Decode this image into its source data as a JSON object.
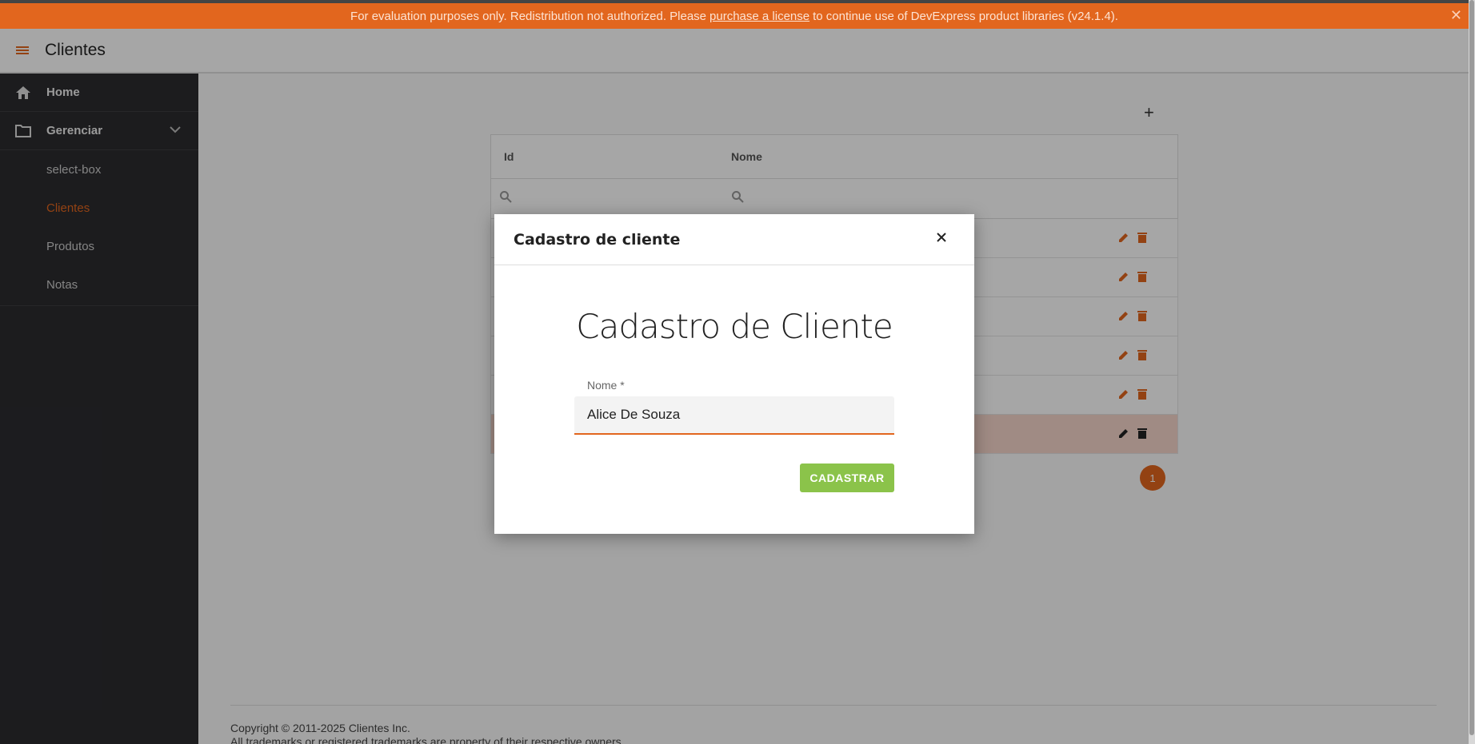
{
  "banner": {
    "text_before": "For evaluation purposes only. Redistribution not authorized. Please",
    "link": "purchase a license",
    "text_after": "to continue use of DevExpress product libraries (v24.1.4)."
  },
  "header": {
    "title": "Clientes"
  },
  "sidebar": {
    "home": "Home",
    "manage": "Gerenciar",
    "items": [
      "select-box",
      "Clientes",
      "Produtos",
      "Notas"
    ]
  },
  "grid": {
    "col_id": "Id",
    "col_name": "Nome",
    "page": "1"
  },
  "footer": {
    "line1": "Copyright © 2011-2025 Clientes Inc.",
    "line2": "All trademarks or registered trademarks are property of their respective owners."
  },
  "modal": {
    "title": "Cadastro de cliente",
    "heading": "Cadastro de Cliente",
    "field_label": "Nome *",
    "field_value": "Alice De Souza",
    "submit_label": "CADASTRAR"
  },
  "colors": {
    "accent": "#e2661e",
    "success": "#8bc34a",
    "sidebar": "#2b2b2f"
  }
}
